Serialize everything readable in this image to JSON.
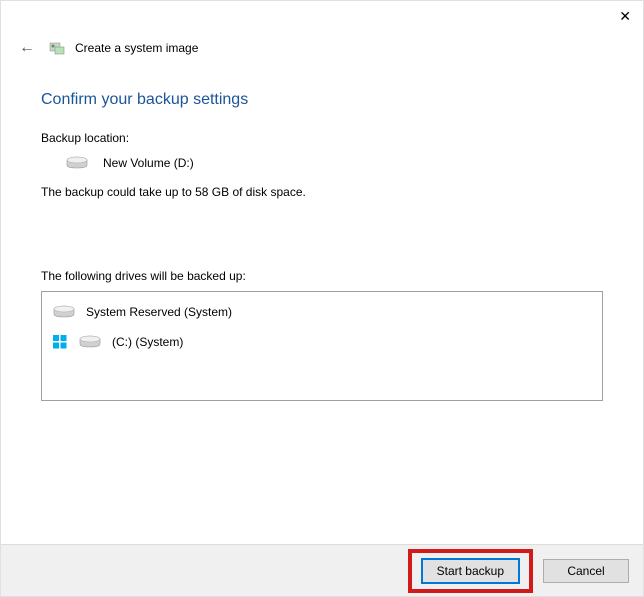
{
  "window": {
    "title": "Create a system image"
  },
  "page": {
    "heading": "Confirm your backup settings",
    "backup_location_label": "Backup location:",
    "backup_location_value": "New Volume (D:)",
    "size_warning": "The backup could take up to 58 GB of disk space.",
    "drives_label": "The following drives will be backed up:",
    "drives": [
      {
        "name": "System Reserved (System)",
        "icon": "drive"
      },
      {
        "name": "(C:) (System)",
        "icon": "windows-drive"
      }
    ]
  },
  "footer": {
    "start_label": "Start backup",
    "cancel_label": "Cancel"
  }
}
